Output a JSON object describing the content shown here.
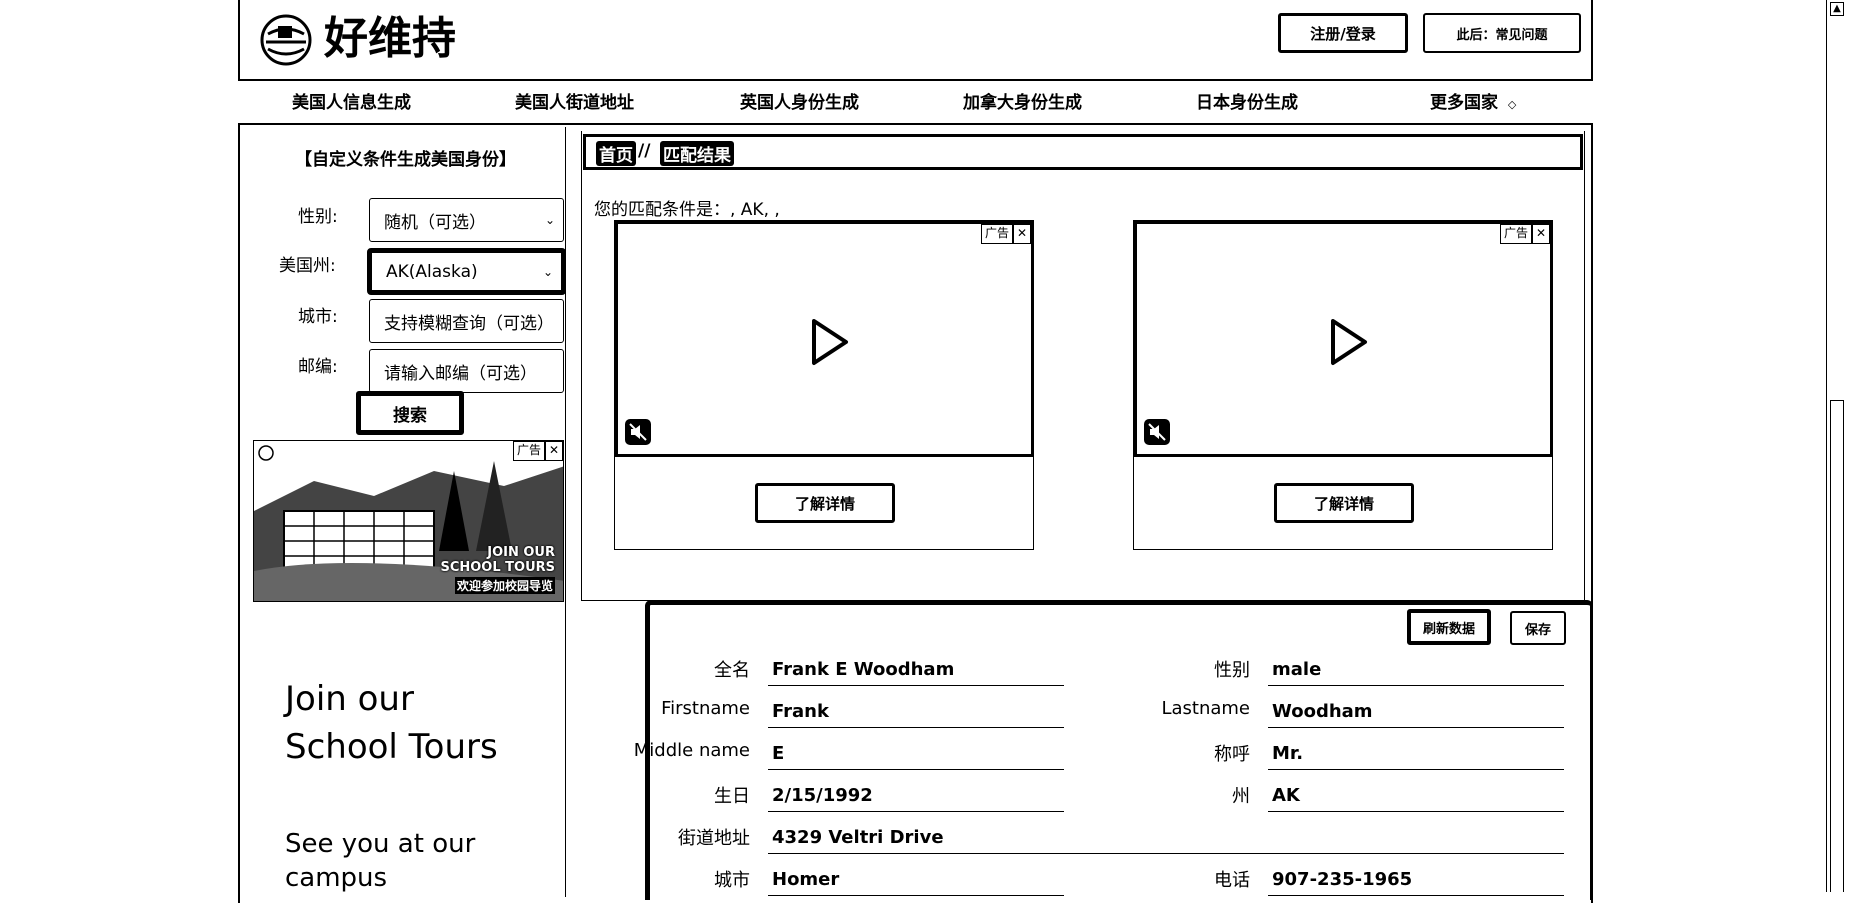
{
  "header": {
    "logo_text": "好维持",
    "login_button": "注册/登录",
    "right_button": "此后：常见问题"
  },
  "nav": {
    "items": [
      "美国人信息生成",
      "美国人街道地址",
      "英国人身份生成",
      "加拿大身份生成",
      "日本身份生成",
      "更多国家"
    ],
    "more_caret": "◇"
  },
  "sidebar": {
    "title": "【自定义条件生成美国身份】",
    "gender_label": "性别:",
    "gender_value": "随机（可选）",
    "state_label": "美国州:",
    "state_value": "AK(Alaska)",
    "city_label": "城市:",
    "city_placeholder": "支持模糊查询（可选）",
    "zip_label": "邮编:",
    "zip_placeholder": "请输入邮编（可选）",
    "search_button": "搜索",
    "ad_badge": "广告",
    "ad_overlay_line1": "JOIN OUR",
    "ad_overlay_line2": "SCHOOL TOURS",
    "ad_overlay_line3": "欢迎参加校园导览",
    "ad_heading": "Join our School Tours",
    "ad_subtext": "See you at our campus"
  },
  "main": {
    "breadcrumb_home": "首页",
    "breadcrumb_sep": "//",
    "breadcrumb_current": "匹配结果",
    "match_text": "您的匹配条件是：, AK, ,",
    "ad_badge": "广告",
    "ad_button": "了解详情",
    "refresh_button": "刷新数据",
    "save_button": "保存"
  },
  "person": {
    "fullname_label": "全名",
    "fullname": "Frank E Woodham",
    "gender_label": "性别",
    "gender": "male",
    "firstname_label": "Firstname",
    "firstname": "Frank",
    "lastname_label": "Lastname",
    "lastname": "Woodham",
    "middlename_label": "Middle name",
    "middlename": "E",
    "title_label": "称呼",
    "title": "Mr.",
    "birthday_label": "生日",
    "birthday": "2/15/1992",
    "state_label": "州",
    "state": "AK",
    "street_label": "街道地址",
    "street": "4329 Veltri Drive",
    "city_label": "城市",
    "city": "Homer",
    "phone_label": "电话",
    "phone": "907-235-1965"
  }
}
